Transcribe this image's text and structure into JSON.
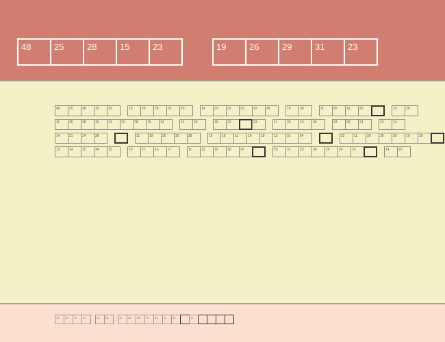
{
  "targets": {
    "group_a": [
      "48",
      "25",
      "28",
      "15",
      "23"
    ],
    "group_b": [
      "19",
      "26",
      "29",
      "31",
      "23"
    ]
  },
  "mid_rows": [
    [
      [
        "48",
        "25",
        "28",
        "15",
        "23"
      ],
      [
        "19",
        "26",
        "29",
        "31",
        "23"
      ],
      [
        "14",
        "23",
        "22",
        "23",
        "23",
        "28"
      ],
      [
        "19",
        "30"
      ],
      [
        "11",
        "25",
        "19",
        "30",
        "_"
      ],
      [
        "19",
        "26"
      ]
    ],
    [
      [
        "11",
        "25",
        "28",
        "15",
        "14",
        "23",
        "28",
        "15",
        "14"
      ],
      [
        "14",
        "23"
      ],
      [
        "19",
        "22",
        "_",
        "23"
      ],
      [
        "11",
        "29",
        "19",
        "30"
      ],
      [
        "24",
        "23",
        "24"
      ],
      [
        "14",
        "14"
      ]
    ],
    [
      [
        "14",
        "31",
        "24",
        "28"
      ],
      [
        "_"
      ],
      [
        "11",
        "19",
        "30",
        "30",
        "28"
      ],
      [
        "19",
        "18",
        "11",
        "19",
        "18",
        "13",
        "31",
        "24"
      ],
      [
        "_"
      ],
      [
        "22",
        "11",
        "29",
        "26",
        "30",
        "19",
        "30",
        "_"
      ]
    ],
    [
      [
        "13",
        "14",
        "15",
        "24",
        "15"
      ],
      [
        "19",
        "27",
        "19",
        "17"
      ],
      [
        "11",
        "13",
        "15",
        "30",
        "25",
        "_"
      ],
      [
        "29",
        "31",
        "23",
        "30",
        "26",
        "24",
        "15",
        "_"
      ],
      [
        "14",
        "22"
      ]
    ]
  ],
  "bottom_rows": [
    [
      [
        "14",
        "15",
        "11",
        "14"
      ],
      [
        "22",
        "26"
      ],
      [
        "11",
        "28",
        "28",
        "19",
        "24",
        "11",
        "22",
        "_",
        "19",
        "_",
        "_",
        "_",
        "_"
      ]
    ]
  ]
}
